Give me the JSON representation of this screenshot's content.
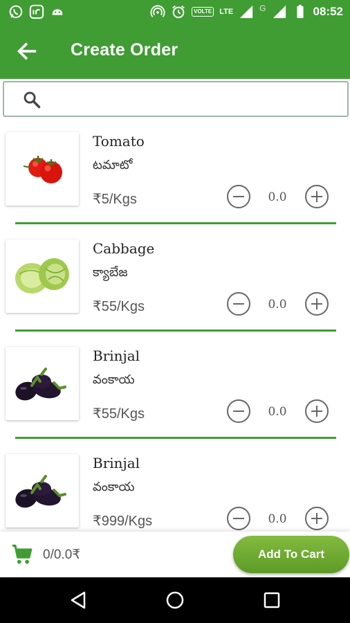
{
  "status_bar": {
    "time": "08:52",
    "volte_label": "VOLTE",
    "lte_label": "LTE",
    "network_label": "G"
  },
  "header": {
    "title": "Create Order"
  },
  "search": {
    "placeholder": ""
  },
  "products": [
    {
      "name": "Tomato",
      "local_name": "టమాటో",
      "price": "₹5/Kgs",
      "quantity": "0.0",
      "image": "tomato"
    },
    {
      "name": "Cabbage",
      "local_name": "క్యాబేజ",
      "price": "₹55/Kgs",
      "quantity": "0.0",
      "image": "cabbage"
    },
    {
      "name": "Brinjal",
      "local_name": "వంకాయ",
      "price": "₹55/Kgs",
      "quantity": "0.0",
      "image": "brinjal"
    },
    {
      "name": "Brinjal",
      "local_name": "వంకాయ",
      "price": "₹999/Kgs",
      "quantity": "0.0",
      "image": "brinjal"
    }
  ],
  "cart": {
    "summary": "0/0.0₹",
    "button_label": "Add To Cart"
  },
  "colors": {
    "primary": "#3f9d33",
    "button": "#6ca832",
    "divider": "#3f9d33"
  }
}
